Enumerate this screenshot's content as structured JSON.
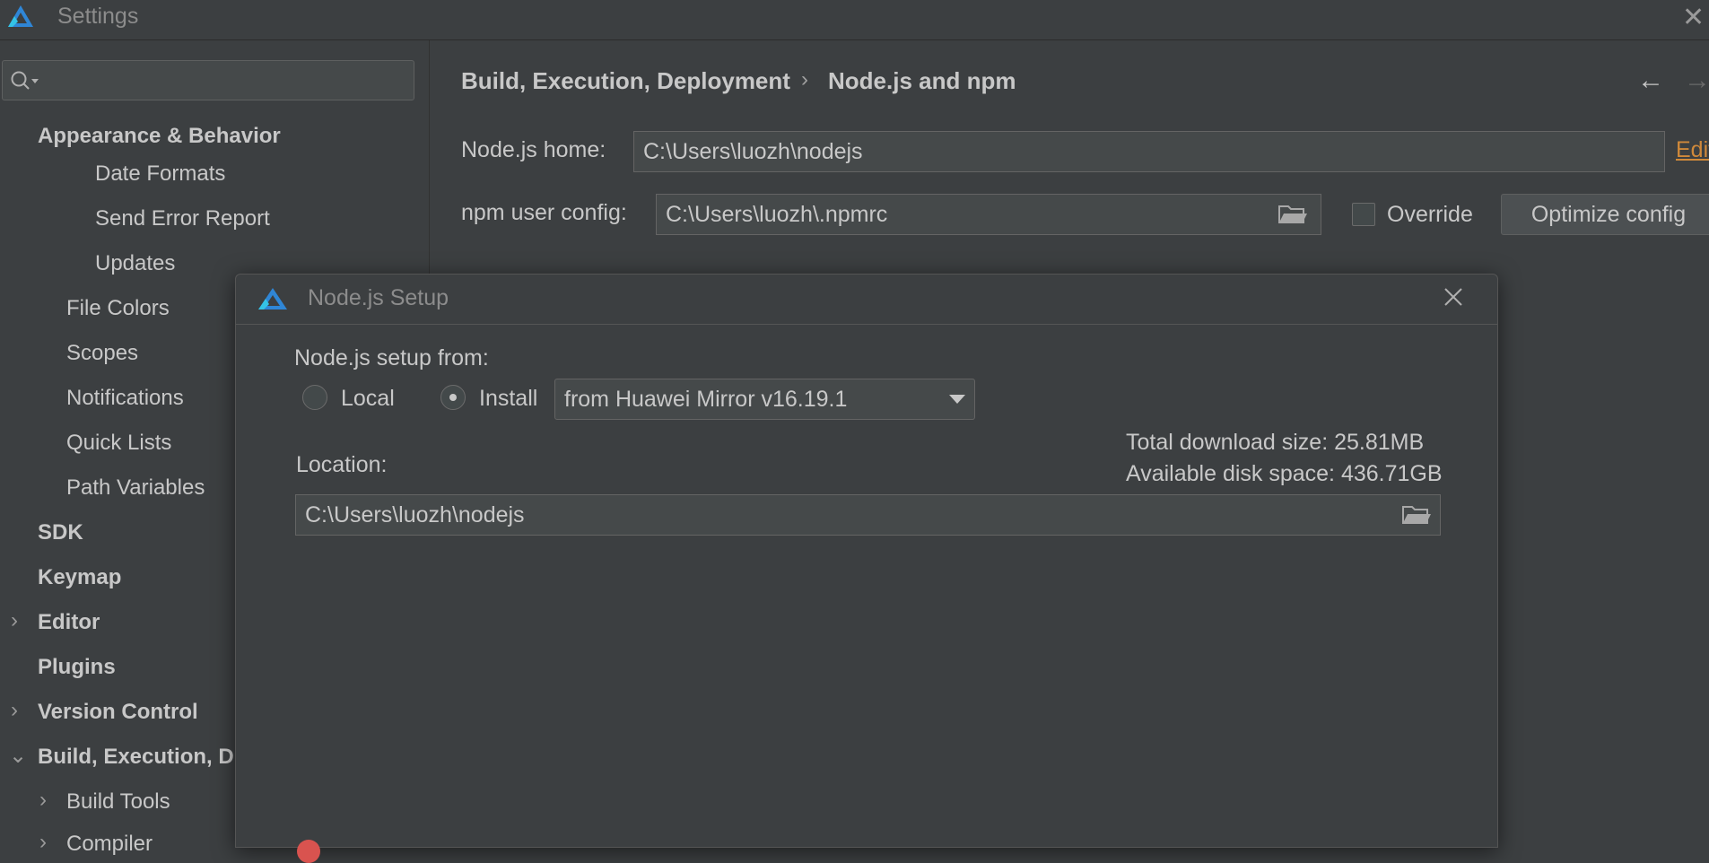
{
  "window": {
    "title": "Settings"
  },
  "sidebar": {
    "search": {
      "value": ""
    },
    "items": [
      {
        "label": "Appearance & Behavior"
      },
      {
        "label": "Date Formats"
      },
      {
        "label": "Send Error Report"
      },
      {
        "label": "Updates"
      },
      {
        "label": "File Colors"
      },
      {
        "label": "Scopes"
      },
      {
        "label": "Notifications"
      },
      {
        "label": "Quick Lists"
      },
      {
        "label": "Path Variables"
      },
      {
        "label": "SDK"
      },
      {
        "label": "Keymap"
      },
      {
        "label": "Editor"
      },
      {
        "label": "Plugins"
      },
      {
        "label": "Version Control"
      },
      {
        "label": "Build, Execution, D"
      },
      {
        "label": "Build Tools"
      },
      {
        "label": "Compiler"
      }
    ]
  },
  "main": {
    "breadcrumb": [
      "Build, Execution, Deployment",
      "Node.js and npm"
    ],
    "node_home": {
      "label": "Node.js home:",
      "value": "C:\\Users\\luozh\\nodejs",
      "edit_link": "Edit"
    },
    "npm_config": {
      "label": "npm user config:",
      "value": "C:\\Users\\luozh\\.npmrc",
      "override_label": "Override",
      "override_checked": false,
      "optimize_label": "Optimize config"
    }
  },
  "dialog": {
    "title": "Node.js Setup",
    "setup_from_label": "Node.js setup from:",
    "radio_local": "Local",
    "radio_install": "Install",
    "selected": "Install",
    "mirror": "from Huawei Mirror v16.19.1",
    "location_label": "Location:",
    "location_value": "C:\\Users\\luozh\\nodejs",
    "download_size": "Total download size: 25.81MB",
    "disk_space": "Available disk space: 436.71GB"
  }
}
